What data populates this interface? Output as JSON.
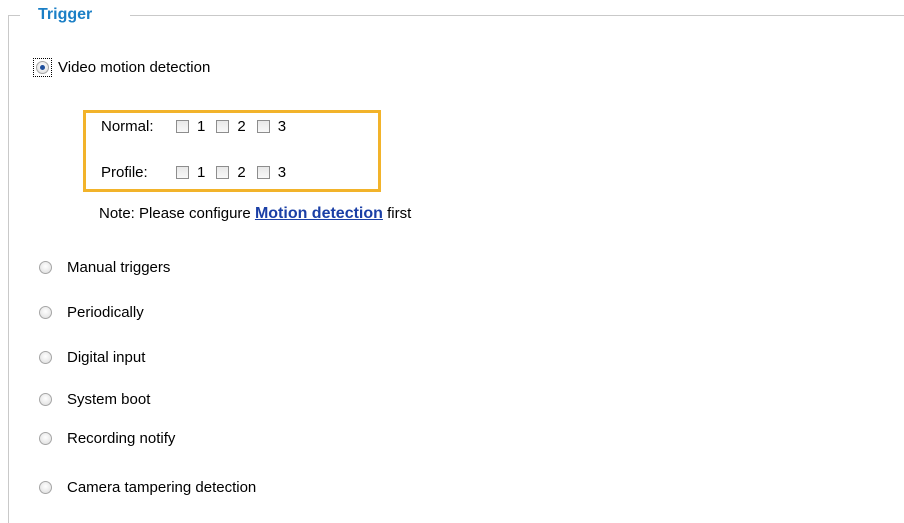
{
  "fieldset": {
    "legend": "Trigger"
  },
  "video_motion": {
    "label": "Video motion detection",
    "normal_label": "Normal:",
    "profile_label": "Profile:",
    "window_numbers": [
      "1",
      "2",
      "3"
    ],
    "note_prefix": "Note: Please configure",
    "note_link": "Motion detection",
    "note_suffix": "first"
  },
  "options": [
    {
      "label": "Manual triggers"
    },
    {
      "label": "Periodically"
    },
    {
      "label": "Digital input"
    },
    {
      "label": "System boot"
    },
    {
      "label": "Recording notify"
    },
    {
      "label": "Camera tampering detection"
    }
  ],
  "selected": "Video motion detection"
}
